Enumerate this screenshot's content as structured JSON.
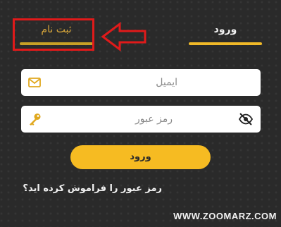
{
  "tabs": {
    "register_label": "ثبت نام",
    "login_label": "ورود"
  },
  "form": {
    "email_placeholder": "ایمیل",
    "password_placeholder": "رمز عبور",
    "submit_label": "ورود",
    "forgot_label": "رمز عبور را فراموش کرده اید؟"
  },
  "watermark": "WWW.ZOOMARZ.COM",
  "icons": {
    "email": "mail-icon",
    "password": "key-icon",
    "toggle": "eye-off-icon"
  },
  "colors": {
    "accent": "#f6bb22",
    "annotation": "#e01a1a",
    "background": "#2b2b2b"
  }
}
